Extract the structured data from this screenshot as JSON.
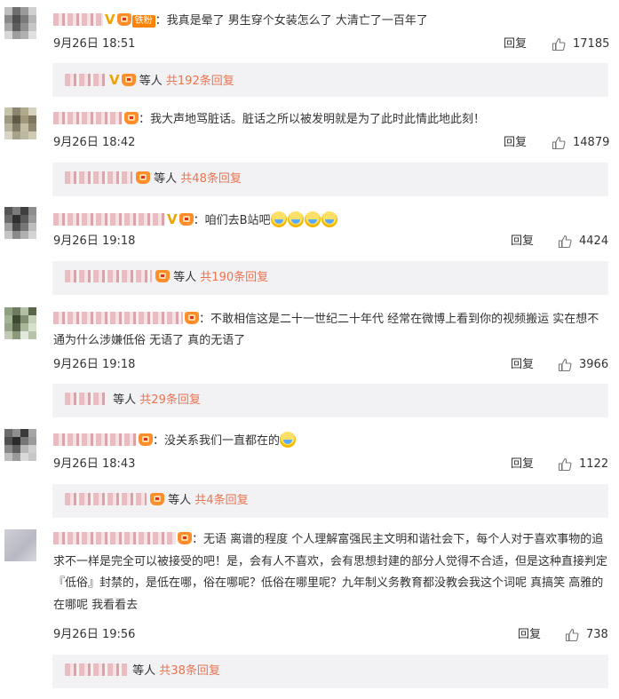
{
  "comments": [
    {
      "text": "我真是晕了 男生穿个女装怎么了 大清亡了一百年了",
      "fan_badge": "铁粉",
      "date": "9月26日",
      "time": "18:51",
      "reply_label": "回复",
      "likes": "17185",
      "sub": {
        "waiting": "等人",
        "count_text": "共192条回复"
      }
    },
    {
      "text": "我大声地骂脏话。脏话之所以被发明就是为了此时此情此地此刻！",
      "date": "9月26日",
      "time": "18:42",
      "reply_label": "回复",
      "likes": "14879",
      "sub": {
        "waiting": "等人",
        "count_text": "共48条回复"
      }
    },
    {
      "text": "咱们去B站吧",
      "date": "9月26日",
      "time": "19:18",
      "reply_label": "回复",
      "likes": "4424",
      "sub": {
        "waiting": "等人",
        "count_text": "共190条回复"
      }
    },
    {
      "text": "不敢相信这是二十一世纪二十年代 经常在微博上看到你的视频搬运 实在想不通为什么涉嫌低俗 无语了 真的无语了",
      "date": "9月26日",
      "time": "19:18",
      "reply_label": "回复",
      "likes": "3966",
      "sub": {
        "waiting": "等人",
        "count_text": "共29条回复"
      }
    },
    {
      "text": "没关系我们一直都在的",
      "date": "9月26日",
      "time": "18:43",
      "reply_label": "回复",
      "likes": "1122",
      "sub": {
        "waiting": "等人",
        "count_text": "共4条回复"
      }
    },
    {
      "text": "无语 离谱的程度 个人理解富强民主文明和谐社会下，每个人对于喜欢事物的追求不一样是完全可以被接受的吧！是，会有人不喜欢，会有思想封建的部分人觉得不合适，但是这种直接判定『低俗』封禁的，是低在哪，俗在哪呢？低俗在哪里呢？九年制义务教育都没教会我这个词呢 真搞笑 高雅的在哪呢 我看看去",
      "date": "9月26日",
      "time": "19:56",
      "reply_label": "回复",
      "likes": "738",
      "sub": {
        "waiting": "等人",
        "count_text": "共38条回复"
      }
    }
  ],
  "colors": {
    "link_orange": "#eb7350",
    "sub_bg": "#f2f2f5",
    "text": "#333333"
  },
  "icons": {
    "like": "thumb-up-icon",
    "member": "member-crown-icon",
    "verified": "verified-v-icon",
    "emoji": "crying-face-emoji"
  }
}
